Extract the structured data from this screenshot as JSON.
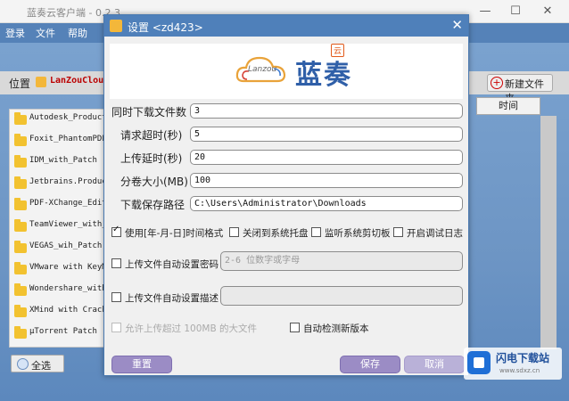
{
  "main": {
    "title": "蓝奏云客户端 - 0.2.3",
    "menu": [
      "登录",
      "文件",
      "帮助"
    ],
    "location_label": "位置",
    "location_value": "LanZouCloud",
    "new_folder_label": "新建文件夹",
    "time_column": "时间",
    "files": [
      "Autodesk_Products",
      "Foxit_PhantomPDF_",
      "IDM_with_Patch",
      "Jetbrains.Product",
      "PDF-XChange_Edito",
      "TeamViewer_with_",
      "VEGAS_wih_Patch",
      "VMware with KeyMa",
      "Wondershare_with_",
      "XMind with Crack",
      "μTorrent Patch"
    ],
    "select_all_label": "全选",
    "window_controls": [
      "—",
      "☐",
      "✕"
    ]
  },
  "dialog": {
    "title": "设置 <zd423>",
    "close_icon": "✕",
    "logo_brand": "蓝奏",
    "logo_sub": "Lanzou",
    "logo_tag": "云",
    "fields": [
      {
        "label": "同时下载文件数",
        "value": "3"
      },
      {
        "label": "请求超时(秒)",
        "value": "5"
      },
      {
        "label": "上传延时(秒)",
        "value": "20"
      },
      {
        "label": "分卷大小(MB)",
        "value": "100"
      },
      {
        "label": "下载保存路径",
        "value": "C:\\Users\\Administrator\\Downloads"
      }
    ],
    "options": [
      {
        "label": "使用[年-月-日]时间格式",
        "checked": true
      },
      {
        "label": "关闭到系统托盘",
        "checked": false
      },
      {
        "label": "监听系统剪切板",
        "checked": false
      },
      {
        "label": "开启调试日志",
        "checked": false
      }
    ],
    "upload_password": {
      "label": "上传文件自动设置密码",
      "placeholder": "2-6 位数字或字母",
      "checked": false
    },
    "upload_desc": {
      "label": "上传文件自动设置描述",
      "checked": false
    },
    "allow_big": {
      "label": "允许上传超过 100MB 的大文件",
      "checked": false
    },
    "auto_update": {
      "label": "自动检测新版本",
      "checked": false
    },
    "reset_label": "重置",
    "save_label": "保存",
    "cancel_label": "取消"
  },
  "watermark": {
    "name": "闪电下载站",
    "url": "www.sdxz.cn"
  }
}
